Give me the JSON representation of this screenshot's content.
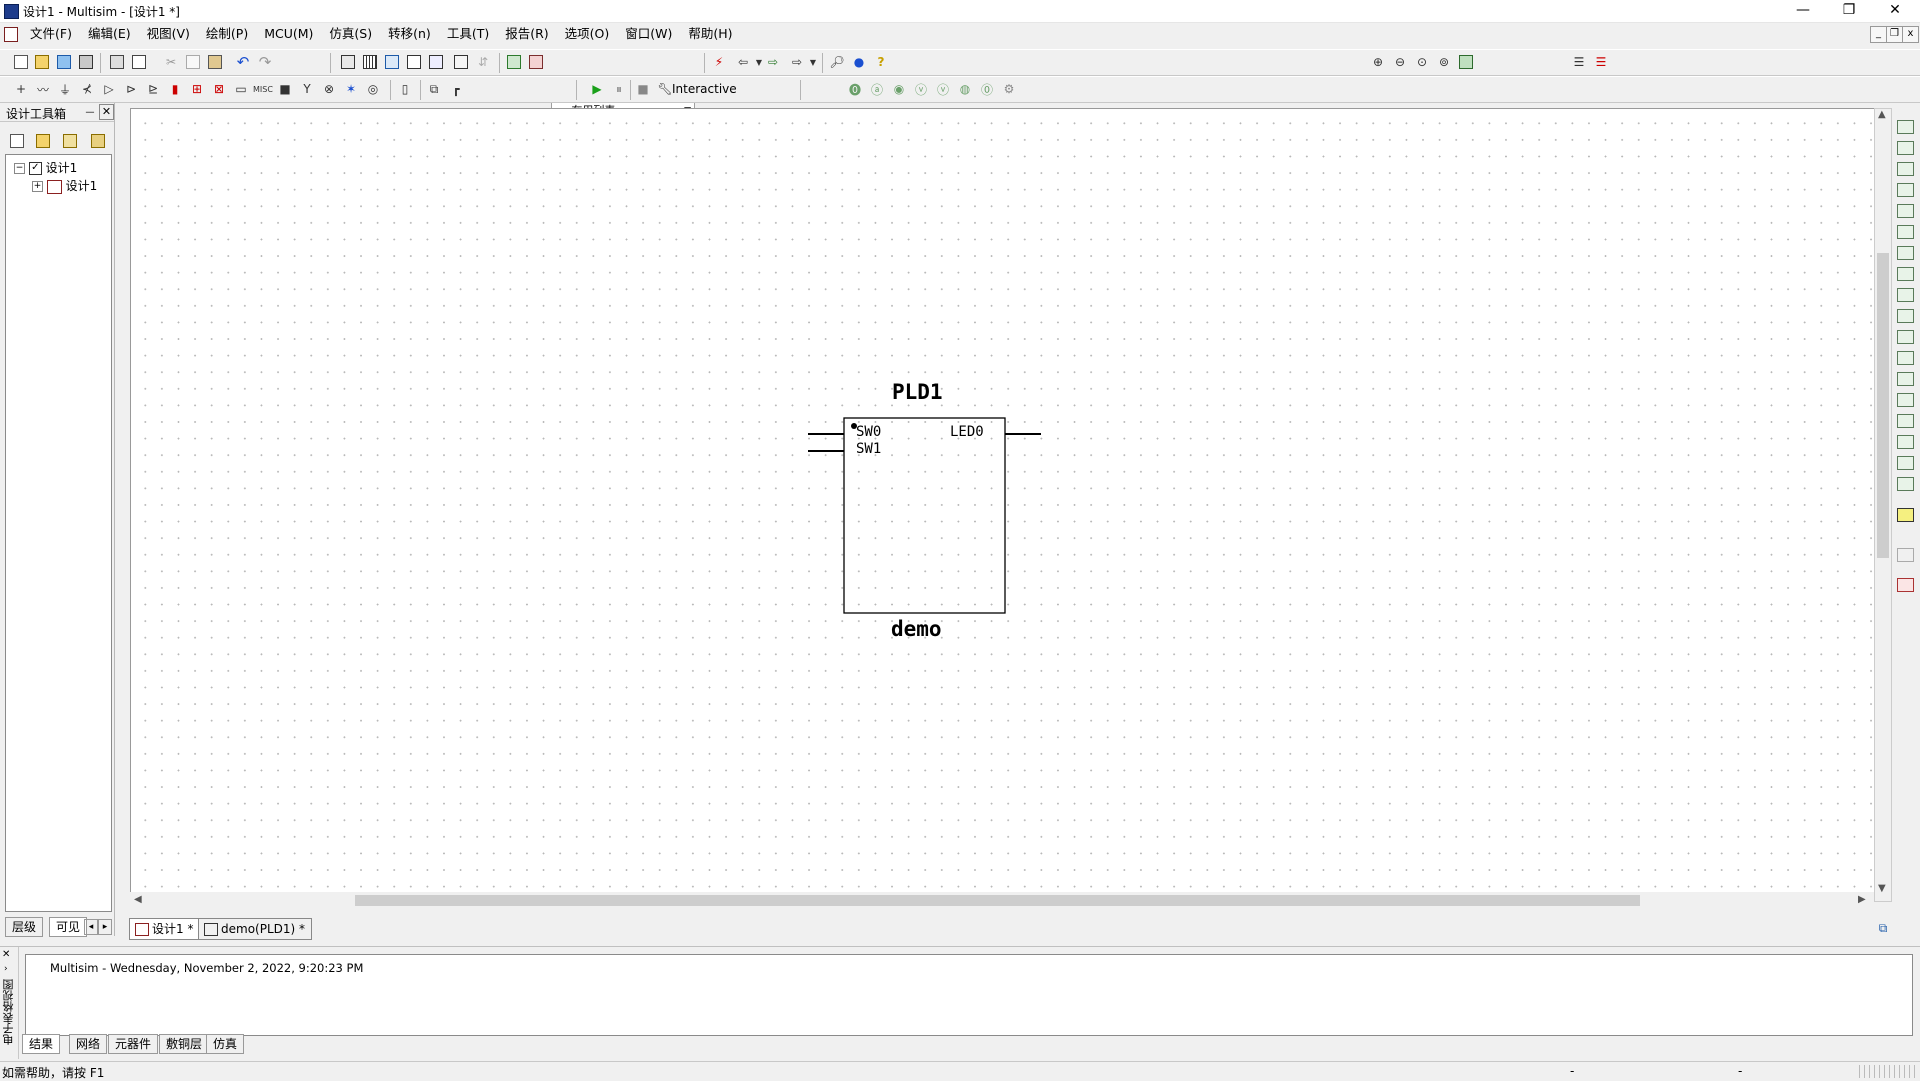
{
  "window": {
    "title": "设计1 - Multisim - [设计1 *]",
    "controls": {
      "minimize": "—",
      "restore": "❐",
      "close": "✕"
    },
    "mdi_controls": {
      "minimize": "_",
      "restore": "❐",
      "close": "x"
    }
  },
  "menu": {
    "items": [
      "文件(F)",
      "编辑(E)",
      "视图(V)",
      "绘制(P)",
      "MCU(M)",
      "仿真(S)",
      "转移(n)",
      "工具(T)",
      "报告(R)",
      "选项(O)",
      "窗口(W)",
      "帮助(H)"
    ]
  },
  "toolbar": {
    "in_use_list": "--- 在用列表 ---",
    "interactive_label": "Interactive"
  },
  "toolbox": {
    "title": "设计工具箱",
    "pin": "ᅳ",
    "close": "✕",
    "tree": {
      "root": {
        "label": "设计1",
        "expander": "−",
        "check": "✓"
      },
      "child": {
        "label": "设计1",
        "expander": "+"
      }
    },
    "tabs": [
      "层级",
      "可见"
    ]
  },
  "schematic": {
    "ref": "PLD1",
    "name": "demo",
    "pins_left": [
      "SW0",
      "SW1"
    ],
    "pins_right": [
      "LED0"
    ]
  },
  "sheet_tabs": [
    "设计1 *",
    "demo(PLD1) *"
  ],
  "spreadsheet": {
    "vertical_label": "电子表格视图",
    "log_line": "Multisim  -  Wednesday, November 2, 2022, 9:20:23 PM",
    "tabs": [
      "结果",
      "网络",
      "元器件",
      "敷铜层",
      "仿真"
    ]
  },
  "statusbar": {
    "help_text": "如需帮助，请按 F1",
    "right_1": "-",
    "right_2": "-"
  }
}
